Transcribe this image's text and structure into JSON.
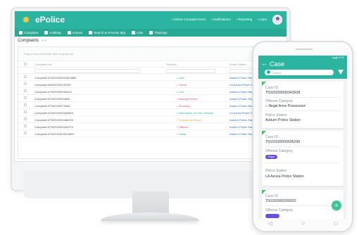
{
  "desktop": {
    "app_title": "ePolice",
    "header_links": [
      "Online Complaint Docs",
      "Notifications",
      "Reporting",
      "Apps"
    ],
    "nav_items": [
      "Complaint",
      "Auditing",
      "Actions",
      "Search & Process Mgt",
      "Lists",
      "Trainings"
    ],
    "page_title": "Complaints",
    "view_toggle": "≡ ▾",
    "group_hint": "Drag a column header here to group by",
    "columns": {
      "number": "Complaint No.",
      "severity": "Severity",
      "police_station": "Police Station"
    },
    "filters": {
      "number": "▾",
      "severity": "▾",
      "police_station": ""
    },
    "rows": [
      {
        "number": "Complaint #T5020200002843883",
        "severity": "Low",
        "severity_color": "#27a97a",
        "police_station": "Auburn Police Station"
      },
      {
        "number": "Complaint #60202002115397",
        "severity": "Threat",
        "severity_color": "#e05260",
        "police_station": "LA Azusa Police Station"
      },
      {
        "number": "Complaint #T5020200036419",
        "severity": "Low",
        "severity_color": "#27a97a",
        "police_station": "Auburn Police Station"
      },
      {
        "number": "Complaint #T502020054896",
        "severity": "Missing Person",
        "severity_color": "#d946a8",
        "police_station": "Auburn Police Station"
      },
      {
        "number": "Complaint #T502020071806",
        "severity": "Shooting",
        "severity_color": "#e05260",
        "police_station": "Auburn Police Station"
      },
      {
        "number": "Complaint #T50202000284800",
        "severity": "Information on Own Welfare",
        "severity_color": "#2bb4a0",
        "police_station": "LA Azusa Police Station"
      },
      {
        "number": "Complaint #T50202000486939",
        "severity": "Suspicious Person",
        "severity_color": "#e6a23c",
        "police_station": "Auburn Police Station"
      },
      {
        "number": "Complaint #T50202000452970",
        "severity": "Offence",
        "severity_color": "#e05260",
        "police_station": "Auburn Police Station"
      },
      {
        "number": "Complaint #T502020025110857",
        "severity": "Trivial",
        "severity_color": "#27a97a",
        "police_station": "Auburn Police Station"
      }
    ]
  },
  "phone": {
    "status_text": "▾◢ ▮ 12:30",
    "title": "Case",
    "search_placeholder": "Search",
    "cards": [
      {
        "case_id_label": "Case ID",
        "case_id": "T5020200005943938",
        "category_label": "Offense Category",
        "category": "Illegal Arms Possession",
        "category_style": "plain",
        "station_label": "Police Station",
        "station": "Auburn Police Station"
      },
      {
        "case_id_label": "Case ID",
        "case_id": "T5020200006696296",
        "category_label": "Offense Category",
        "category": "Rape",
        "category_style": "chip",
        "station_label": "Police Station",
        "station": "LA Azusa Police Station"
      },
      {
        "case_id_label": "Case ID",
        "case_id": "T50202000209922",
        "category_label": "Offense Category",
        "category": "",
        "category_style": "chip",
        "station_label": "",
        "station": ""
      }
    ],
    "fab": "+",
    "nav_buttons": [
      "◁",
      "○",
      "□"
    ]
  },
  "colors": {
    "brand": "#2bb4a0",
    "chip": "#6a4fd6",
    "fab": "#3ec59a"
  },
  "icons": [
    "star-logo-icon",
    "user-avatar-icon",
    "back-arrow-icon",
    "filter-icon",
    "search-icon",
    "add-icon"
  ]
}
